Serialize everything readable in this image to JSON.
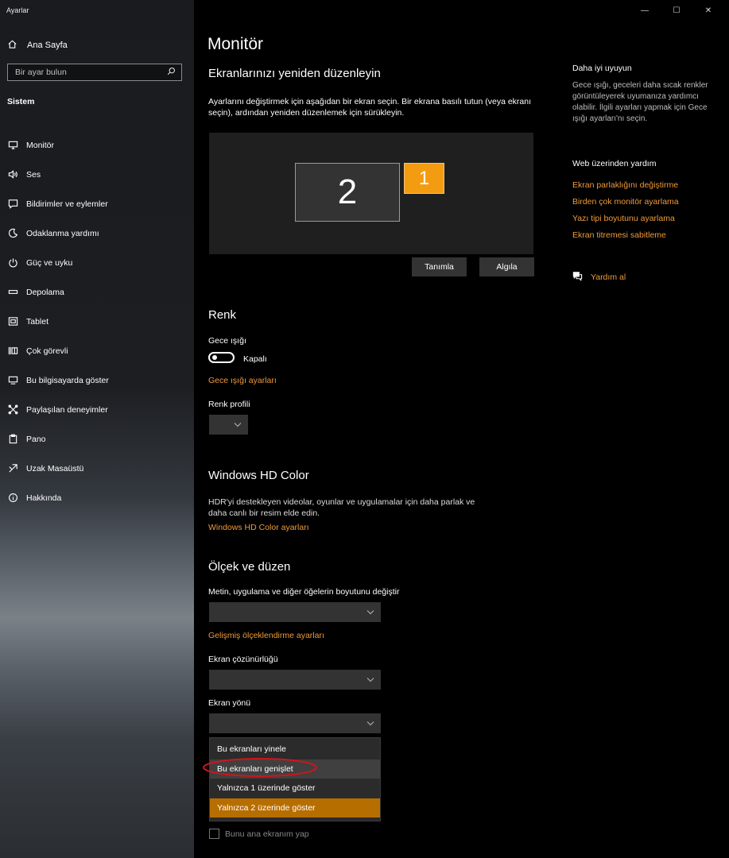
{
  "app": {
    "title": "Ayarlar"
  },
  "window_controls": {
    "minimize": "—",
    "maximize": "☐",
    "close": "✕"
  },
  "sidebar": {
    "home": "Ana Sayfa",
    "search_placeholder": "Bir ayar bulun",
    "section": "Sistem",
    "items": [
      {
        "label": "Monitör",
        "icon": "monitor-icon"
      },
      {
        "label": "Ses",
        "icon": "speaker-icon"
      },
      {
        "label": "Bildirimler ve eylemler",
        "icon": "notification-icon"
      },
      {
        "label": "Odaklanma yardımı",
        "icon": "moon-icon"
      },
      {
        "label": "Güç ve uyku",
        "icon": "power-icon"
      },
      {
        "label": "Depolama",
        "icon": "storage-icon"
      },
      {
        "label": "Tablet",
        "icon": "tablet-icon"
      },
      {
        "label": "Çok görevli",
        "icon": "multitask-icon"
      },
      {
        "label": "Bu bilgisayarda göster",
        "icon": "project-icon"
      },
      {
        "label": "Paylaşılan deneyimler",
        "icon": "shared-icon"
      },
      {
        "label": "Pano",
        "icon": "clipboard-icon"
      },
      {
        "label": "Uzak Masaüstü",
        "icon": "remote-icon"
      },
      {
        "label": "Hakkında",
        "icon": "info-icon"
      }
    ]
  },
  "main": {
    "title": "Monitör",
    "rearrange": {
      "heading": "Ekranlarınızı yeniden düzenleyin",
      "desc_line1": "Ayarlarını değiştirmek için aşağıdan bir ekran seçin. Bir ekrana basılı tutun (veya ekranı",
      "desc_line2": "seçin), ardından yeniden düzenlemek için sürükleyin.",
      "monitor_2": "2",
      "monitor_1": "1",
      "identify_button": "Tanımla",
      "detect_button": "Algıla"
    },
    "color": {
      "heading": "Renk",
      "night_light_label": "Gece ışığı",
      "toggle_state": "Kapalı",
      "night_light_settings": "Gece ışığı ayarları",
      "color_profile_label": "Renk profili"
    },
    "hdr": {
      "heading": "Windows HD Color",
      "desc_line1": "HDR'yi destekleyen videolar, oyunlar ve uygulamalar için daha parlak ve",
      "desc_line2": "daha canlı bir resim elde edin.",
      "link": "Windows HD Color ayarları"
    },
    "scale": {
      "heading": "Ölçek ve düzen",
      "size_label": "Metin, uygulama ve diğer öğelerin boyutunu değiştir",
      "advanced_link": "Gelişmiş ölçeklendirme ayarları",
      "resolution_label": "Ekran çözünürlüğü",
      "orientation_label": "Ekran yönü"
    },
    "multiple_displays": {
      "options": [
        "Bu ekranları yinele",
        "Bu ekranları genişlet",
        "Yalnızca 1 üzerinde göster",
        "Yalnızca 2 üzerinde göster"
      ],
      "hovered": "Bu ekranları genişlet",
      "selected": "Yalnızca 2 üzerinde göster",
      "annotation_color": "#d0141b",
      "main_display_checkbox": "Bunu ana ekranım yap"
    }
  },
  "help": {
    "sync_title": "Daha iyi uyuyun",
    "sync_text": "Gece ışığı, geceleri daha sıcak renkler görüntüleyerek uyumanıza yardımcı olabilir. İlgili ayarları yapmak için Gece ışığı ayarları'nı seçin.",
    "web_title": "Web üzerinden yardım",
    "links": [
      "Ekran parlaklığını değiştirme",
      "Birden çok monitör ayarlama",
      "Yazı tipi boyutunu ayarlama",
      "Ekran titremesi sabitleme"
    ],
    "get_help": "Yardım al"
  },
  "colors": {
    "accent": "#f09a3a",
    "selected": "#b76e00",
    "monitor_1": "#f39c12"
  }
}
